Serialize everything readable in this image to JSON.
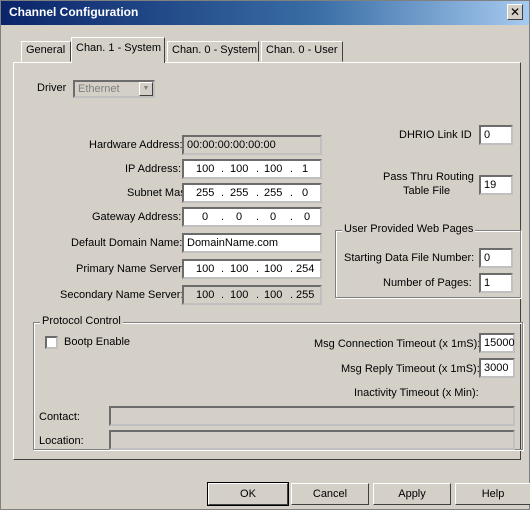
{
  "window": {
    "title": "Channel Configuration",
    "close_glyph": "✕"
  },
  "tabs": [
    {
      "label": "General"
    },
    {
      "label": "Chan. 1 - System"
    },
    {
      "label": "Chan. 0 - System"
    },
    {
      "label": "Chan. 0 - User"
    }
  ],
  "driver": {
    "label": "Driver",
    "value": "Ethernet"
  },
  "network": {
    "hardware_address_label": "Hardware Address:",
    "hardware_address_value": "00:00:00:00:00:00",
    "ip_label": "IP Address:",
    "ip": [
      "100",
      "100",
      "100",
      "1"
    ],
    "subnet_label": "Subnet Mask:",
    "subnet": [
      "255",
      "255",
      "255",
      "0"
    ],
    "gateway_label": "Gateway Address:",
    "gateway": [
      "0",
      "0",
      "0",
      "0"
    ],
    "domain_label": "Default Domain Name:",
    "domain_value": "DomainName.com",
    "primary_label": "Primary Name Server:",
    "primary": [
      "100",
      "100",
      "100",
      "254"
    ],
    "secondary_label": "Secondary Name Server:",
    "secondary": [
      "100",
      "100",
      "100",
      "255"
    ]
  },
  "dhrio": {
    "label": "DHRIO Link ID",
    "value": "0"
  },
  "passthru": {
    "label_line1": "Pass Thru Routing",
    "label_line2": "Table File",
    "value": "19"
  },
  "web_pages": {
    "legend": "User Provided Web Pages",
    "start_label": "Starting Data File Number:",
    "start_value": "0",
    "count_label": "Number of Pages:",
    "count_value": "1"
  },
  "protocol": {
    "legend": "Protocol Control",
    "bootp_label": "Bootp Enable",
    "bootp_checked": false,
    "conn_timeout_label": "Msg Connection Timeout (x 1mS):",
    "conn_timeout_value": "15000",
    "reply_timeout_label": "Msg Reply Timeout (x 1mS):",
    "reply_timeout_value": "3000",
    "inactivity_label": "Inactivity Timeout (x Min):",
    "contact_label": "Contact:",
    "contact_value": "",
    "location_label": "Location:",
    "location_value": ""
  },
  "buttons": {
    "ok": "OK",
    "cancel": "Cancel",
    "apply": "Apply",
    "help": "Help"
  }
}
